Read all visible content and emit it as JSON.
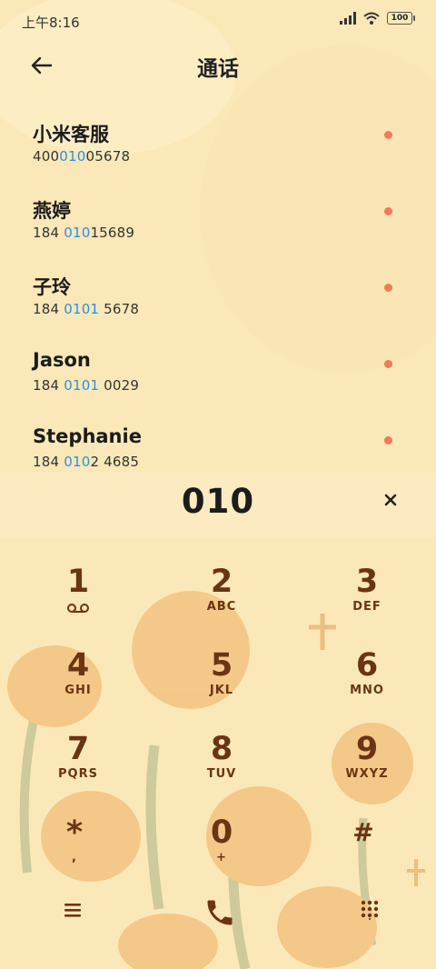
{
  "status_bar": {
    "time": "上午8:16",
    "battery": "100",
    "icons": [
      "signal-icon",
      "wifi-icon",
      "battery-icon"
    ]
  },
  "header": {
    "title": "通话",
    "back_icon": "arrow-left-icon"
  },
  "results": [
    {
      "name": "小米客服",
      "num_pre": "400",
      "num_hl": "010",
      "num_post": "05678"
    },
    {
      "name": "燕婷",
      "num_pre": "184 ",
      "num_hl": "010",
      "num_post": "15689"
    },
    {
      "name": "子玲",
      "num_pre": "184 ",
      "num_hl": "0101",
      "num_post": " 5678"
    },
    {
      "name": "Jason",
      "num_pre": "184 ",
      "num_hl": "0101",
      "num_post": " 0029"
    },
    {
      "name": "Stephanie",
      "num_pre": "184 ",
      "num_hl": "010",
      "num_post": "2 4685"
    }
  ],
  "dial": {
    "digits": "010",
    "clear_icon": "close-icon"
  },
  "keypad": {
    "keys": [
      {
        "digit": "1",
        "letters": "voicemail-icon"
      },
      {
        "digit": "2",
        "letters": "ABC"
      },
      {
        "digit": "3",
        "letters": "DEF"
      },
      {
        "digit": "4",
        "letters": "GHI"
      },
      {
        "digit": "5",
        "letters": "JKL"
      },
      {
        "digit": "6",
        "letters": "MNO"
      },
      {
        "digit": "7",
        "letters": "PQRS"
      },
      {
        "digit": "8",
        "letters": "TUV"
      },
      {
        "digit": "9",
        "letters": "WXYZ"
      },
      {
        "digit": "*",
        "letters": ","
      },
      {
        "digit": "0",
        "letters": "+"
      },
      {
        "digit": "#",
        "letters": ""
      }
    ]
  },
  "bottom_bar": {
    "icons": [
      "menu-icon",
      "call-icon",
      "dialpad-icon"
    ]
  },
  "colors": {
    "background": "#fbe8b8",
    "highlight": "#2f8fe0",
    "dot": "#f07a5c",
    "keypad_text": "#6b3414",
    "rose": "#f0b46a",
    "stem": "#b9c48c"
  }
}
